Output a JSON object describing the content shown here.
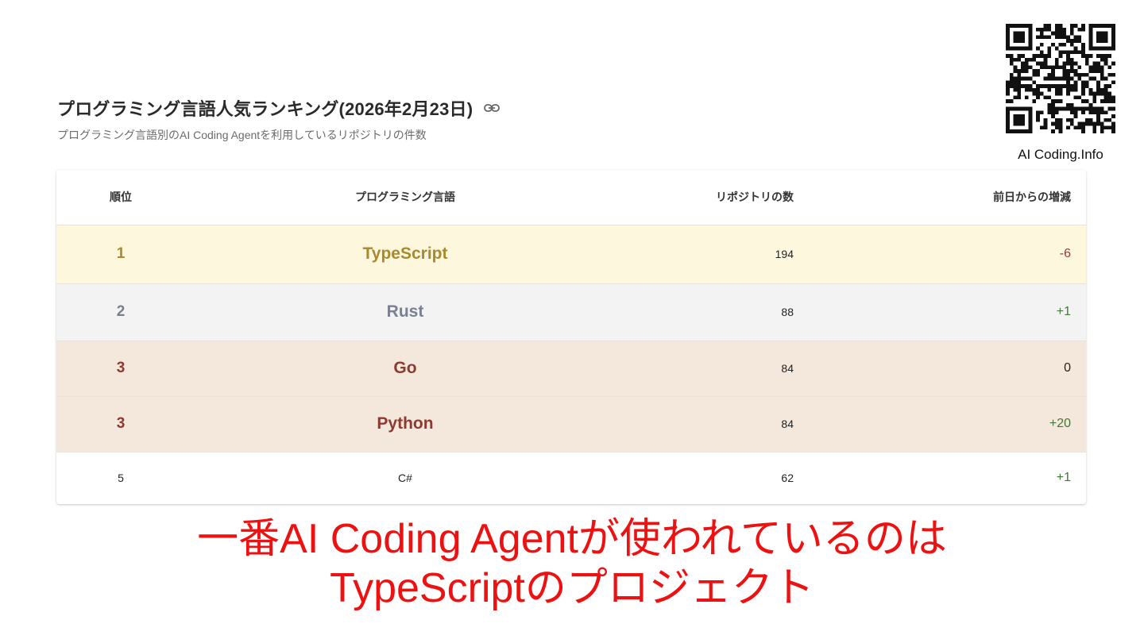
{
  "header": {
    "title": "プログラミング言語人気ランキング(2026年2月23日)",
    "subtitle": "プログラミング言語別のAI Coding Agentを利用しているリポジトリの件数",
    "link_icon": "link-icon"
  },
  "brand": {
    "name": "AI Coding.Info",
    "qr_icon": "qr-code-icon"
  },
  "table": {
    "headers": {
      "rank": "順位",
      "language": "プログラミング言語",
      "count": "リポジトリの数",
      "diff": "前日からの増減"
    },
    "rows": [
      {
        "rank": "1",
        "language": "TypeScript",
        "count": "194",
        "diff": "-6"
      },
      {
        "rank": "2",
        "language": "Rust",
        "count": "88",
        "diff": "+1"
      },
      {
        "rank": "3",
        "language": "Go",
        "count": "84",
        "diff": "0"
      },
      {
        "rank": "3",
        "language": "Python",
        "count": "84",
        "diff": "+20"
      },
      {
        "rank": "5",
        "language": "C#",
        "count": "62",
        "diff": "+1"
      }
    ]
  },
  "caption": {
    "line1": "一番AI Coding Agentが使われているのは",
    "line2": "TypeScriptのプロジェクト"
  },
  "colors": {
    "gold_row": "#fdf7de",
    "silver_row": "#f3f3f4",
    "bronze_row": "#f4e7dc",
    "caption": "#ee1111",
    "diff_negative": "#9a3b32",
    "diff_positive": "#3f7a34"
  }
}
